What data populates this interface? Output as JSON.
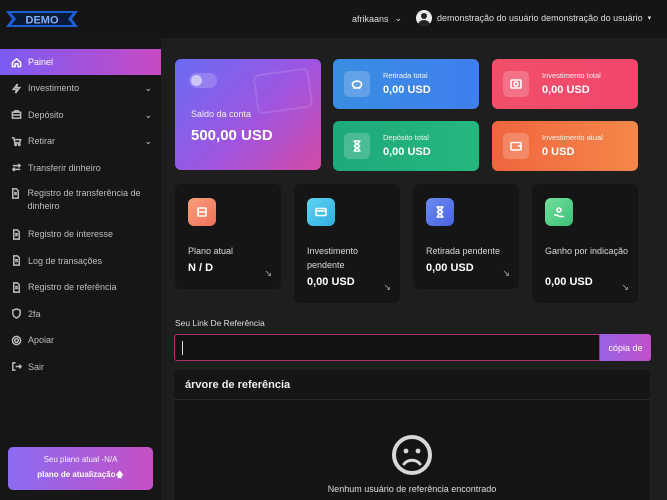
{
  "brand": {
    "logo_text": "DEMO",
    "accent": "#2a6cf0"
  },
  "topbar": {
    "language": "afrikaans",
    "user_name": "demonstração do usuário demonstração do usuário"
  },
  "sidebar": {
    "items": [
      {
        "label": "Painel",
        "icon": "home-icon"
      },
      {
        "label": "Investimento",
        "icon": "bolt-icon"
      },
      {
        "label": "Depósito",
        "icon": "briefcase-icon"
      },
      {
        "label": "Retirar",
        "icon": "cart-icon"
      },
      {
        "label": "Transferir dinheiro",
        "icon": "transfer-icon"
      },
      {
        "label": "Registro de transferência de dinheiro",
        "icon": "file-icon"
      },
      {
        "label": "Registro de interesse",
        "icon": "file-icon"
      },
      {
        "label": "Log de transações",
        "icon": "file-icon"
      },
      {
        "label": "Registro de referência",
        "icon": "file-icon"
      },
      {
        "label": "2fa",
        "icon": "shield-icon"
      },
      {
        "label": "Apoiar",
        "icon": "support-icon"
      },
      {
        "label": "Sair",
        "icon": "logout-icon"
      }
    ],
    "upgrade": {
      "plan_text": "Seu plano atual -N/A",
      "button_label": "plano de atualização🡅"
    }
  },
  "balance": {
    "label": "Saldo da conta",
    "value": "500,00 USD"
  },
  "stats": {
    "withdraw_total": {
      "label": "Retirada total",
      "value": "0,00 USD",
      "color": "#3a8de0"
    },
    "invest_total": {
      "label": "Investimento total",
      "value": "0,00 USD",
      "color": "#f0506a"
    },
    "deposit_total": {
      "label": "Depósito total",
      "value": "0,00 USD",
      "color": "#1fa97a"
    },
    "invest_current": {
      "label": "Investimento atual",
      "value": "0 USD",
      "color": "#f0653e"
    }
  },
  "info": {
    "plan": {
      "label": "Plano atual",
      "value": "N / D"
    },
    "pending_invest": {
      "label": "Investimento pendente",
      "value": "0,00 USD"
    },
    "pending_withdraw": {
      "label": "Retirada pendente",
      "value": "0,00 USD"
    },
    "referral_gain": {
      "label": "Ganho por indicação",
      "value": "0,00 USD"
    }
  },
  "referral": {
    "label": "Seu Link De Referência",
    "link_value": "",
    "copy_label": "cópia de"
  },
  "tree": {
    "title": "árvore de referência",
    "empty_text": "Nenhum usuário de referência encontrado"
  }
}
